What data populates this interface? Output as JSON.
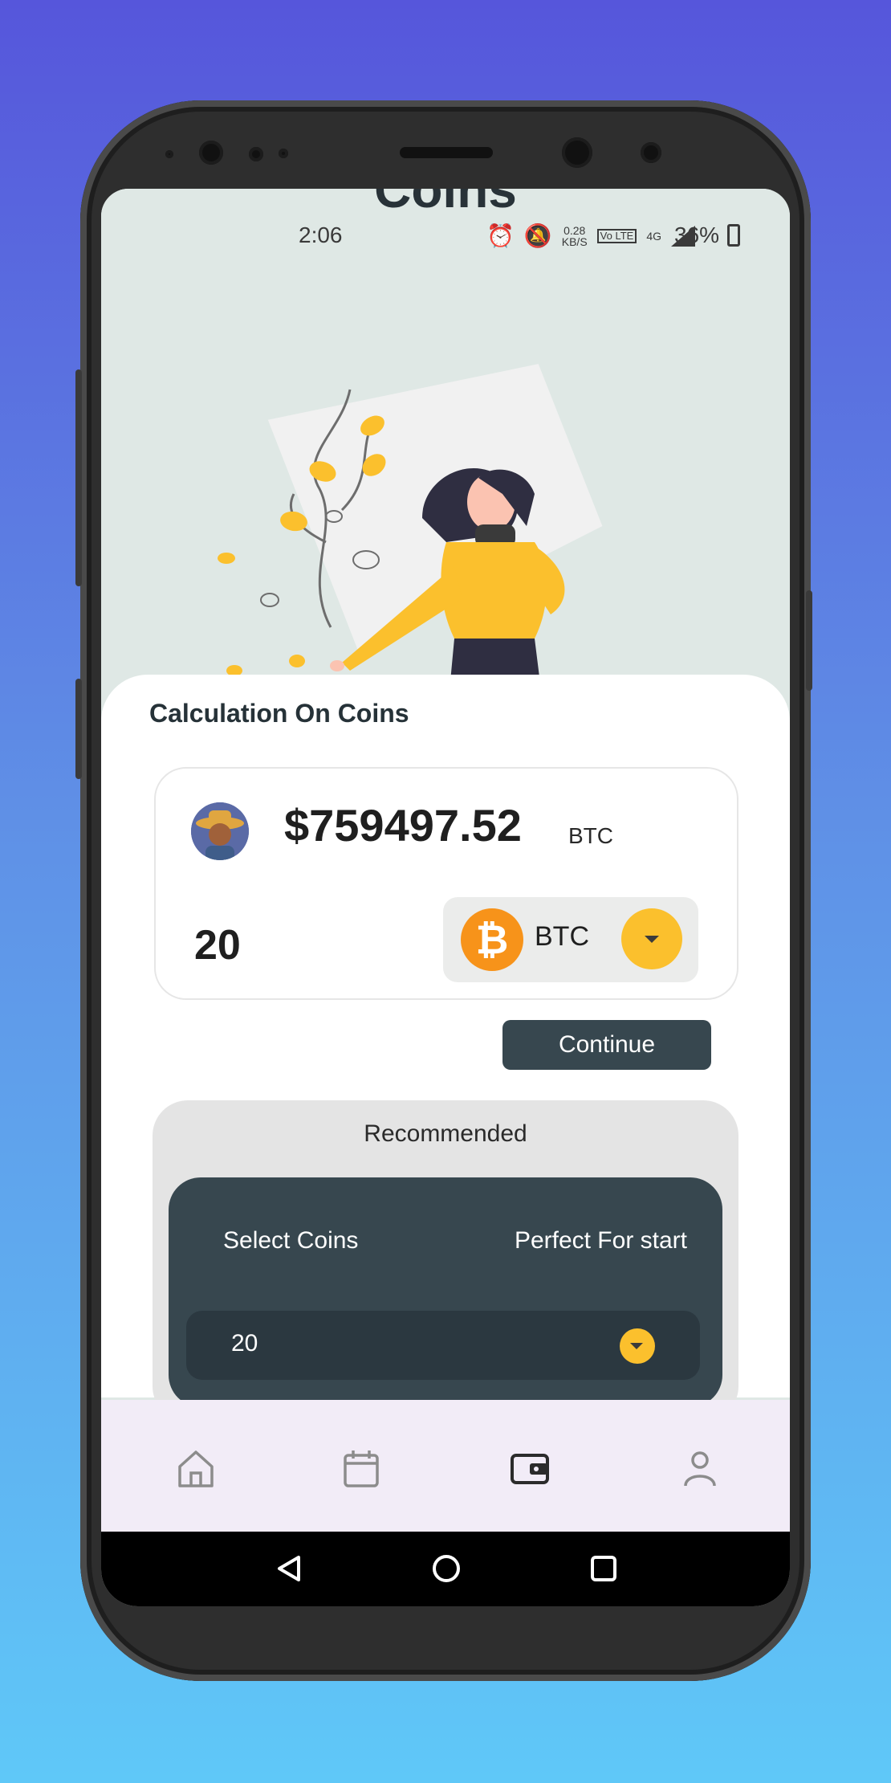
{
  "status_bar": {
    "time": "2:06",
    "speed": "0.28",
    "speed_unit": "KB/S",
    "volte": "Vo LTE",
    "network": "4G",
    "battery": "36%"
  },
  "hero": {
    "title": "Coins"
  },
  "calculation": {
    "title": "Calculation On Coins",
    "price": "$759497.52",
    "price_unit": "BTC",
    "amount": "20",
    "coin_symbol": "₿",
    "coin": "BTC",
    "continue_label": "Continue"
  },
  "recommended": {
    "title": "Recommended",
    "left_label": "Select Coins",
    "right_label": "Perfect For start",
    "select_value": "20"
  },
  "bottom_nav": {
    "items": [
      {
        "icon": "home-icon"
      },
      {
        "icon": "calendar-icon"
      },
      {
        "icon": "wallet-icon",
        "active": true
      },
      {
        "icon": "person-icon"
      }
    ]
  },
  "colors": {
    "accent": "#fbc02d",
    "dark": "#37474f",
    "bitcoin": "#f7931a",
    "hero_bg": "#dfe8e5",
    "nav_bg": "#f2ecf7"
  }
}
